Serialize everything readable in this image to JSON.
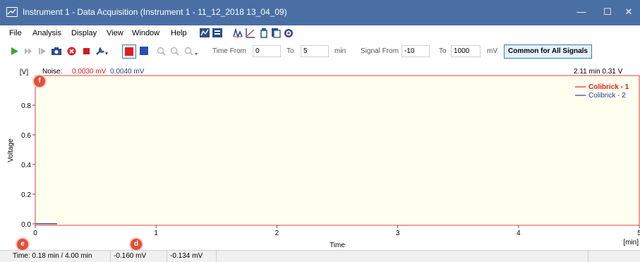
{
  "window": {
    "title": "Instrument 1 - Data Acquisition (Instrument 1 - 11_12_2018 13_04_09)",
    "minimize": "—",
    "maximize": "☐",
    "close": "✕",
    "titlebar_color": "#4a6fa5"
  },
  "menu": {
    "items": [
      "File",
      "Analysis",
      "Display",
      "View",
      "Window",
      "Help"
    ],
    "icons": [
      "chromatogram-overlay-icon",
      "peak-table-icon",
      "integration-icon",
      "calibration-icon",
      "sample-vial-icon",
      "report-icon",
      "target-icon"
    ]
  },
  "toolbar": {
    "time_from_label": "Time From",
    "time_from_value": "0",
    "time_to_label": "To",
    "time_to_value": "5",
    "time_unit": "min",
    "signal_from_label": "Signal From",
    "signal_from_value": "-10",
    "signal_to_label": "To",
    "signal_to_value": "1000",
    "signal_unit": "mV",
    "common_button": "Common for All Signals",
    "icons": [
      "play-icon",
      "fast-forward-icon",
      "step-forward-icon",
      "camera-icon",
      "stop-circle-icon",
      "stop-square-icon",
      "wrench-icon",
      "signal-red-icon",
      "signal-blue-icon",
      "zoom-in-icon",
      "zoom-out-icon",
      "zoom-reset-icon"
    ]
  },
  "chart_header": {
    "noise_label": "Noise:",
    "noise_1": "0.0030 mV",
    "noise_2": "0.0040 mV",
    "cursor_readout": "2.11 min  0.31 V"
  },
  "badges": {
    "f": "f",
    "e": "e",
    "d": "d"
  },
  "chart_data": {
    "type": "line",
    "xlabel": "Time",
    "ylabel": "Voltage",
    "x_unit": "[min]",
    "y_unit": "[V]",
    "xlim": [
      0,
      5
    ],
    "ylim": [
      -0.01,
      1.0
    ],
    "x_ticks": [
      0,
      1,
      2,
      3,
      4,
      5
    ],
    "y_ticks": [
      "0.0",
      "0.2",
      "0.4",
      "0.6",
      "0.8"
    ],
    "plot_background": "#fffff0",
    "plot_border": "#e04040",
    "legend_position": "top-right",
    "series": [
      {
        "name": "Colibrick - 1",
        "color": "#e02020",
        "bold": true,
        "x": [
          0,
          0.18
        ],
        "y": [
          0,
          0
        ]
      },
      {
        "name": "Colibrick - 2",
        "color": "#2a3e9e",
        "bold": false,
        "x": [
          0,
          0.18
        ],
        "y": [
          0,
          0
        ]
      }
    ]
  },
  "status": {
    "time": "Time: 0.18 min / 4.00 min",
    "signal_1": "-0.160 mV",
    "signal_2": "-0.134 mV"
  }
}
